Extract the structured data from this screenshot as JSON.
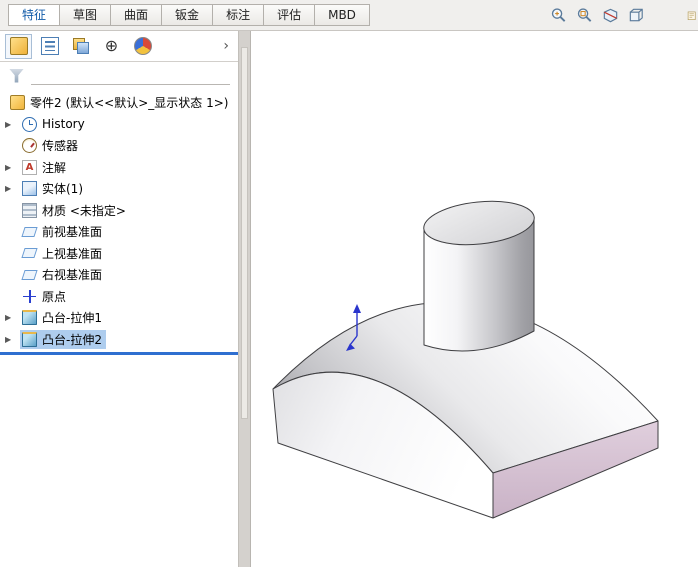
{
  "colors": {
    "selection_highlight": "#aecdee",
    "rollback_bar": "#2f6fd0",
    "right_face_pink": "#d6c0d4",
    "accent_blue": "#0f5aa8"
  },
  "ribbon": {
    "tabs": [
      {
        "id": "features",
        "label": "特征",
        "active": true
      },
      {
        "id": "sketch",
        "label": "草图",
        "active": false
      },
      {
        "id": "surfaces",
        "label": "曲面",
        "active": false
      },
      {
        "id": "sheet-metal",
        "label": "钣金",
        "active": false
      },
      {
        "id": "markup",
        "label": "标注",
        "active": false
      },
      {
        "id": "evaluate",
        "label": "评估",
        "active": false
      },
      {
        "id": "mbd",
        "label": "MBD",
        "active": false
      }
    ],
    "quick_icons": [
      {
        "name": "zoom-previous-icon",
        "clipped": false
      },
      {
        "name": "zoom-fit-icon",
        "clipped": false
      },
      {
        "name": "section-view-icon",
        "clipped": false
      },
      {
        "name": "view-orientation-icon",
        "clipped": false
      },
      {
        "name": "document-icon",
        "clipped": true
      }
    ]
  },
  "panel": {
    "expand_glyph": "▶",
    "tabs_overflow": "›",
    "tabs": [
      {
        "name": "featuremanager-tab",
        "icon": "feature",
        "active": true,
        "glyph": ""
      },
      {
        "name": "propertymanager-tab",
        "icon": "property",
        "active": false,
        "glyph": ""
      },
      {
        "name": "configurationmanager-tab",
        "icon": "config",
        "active": false,
        "glyph": ""
      },
      {
        "name": "dimxpertmanager-tab",
        "icon": "dimxpert",
        "active": false,
        "glyph": "⊕"
      },
      {
        "name": "displaymanager-tab",
        "icon": "display",
        "active": false,
        "glyph": ""
      }
    ],
    "tree": {
      "root": {
        "label": "零件2 (默认<<默认>_显示状态 1>)"
      },
      "items": [
        {
          "id": "history",
          "label": "History",
          "icon": "history",
          "arrow": true,
          "selected": false
        },
        {
          "id": "sensors",
          "label": "传感器",
          "icon": "sensor",
          "arrow": false,
          "selected": false
        },
        {
          "id": "annotations",
          "label": "注解",
          "icon": "annot",
          "arrow": true,
          "selected": false
        },
        {
          "id": "solid-bodies",
          "label": "实体(1)",
          "icon": "bodies",
          "arrow": true,
          "selected": false
        },
        {
          "id": "material",
          "label": "材质 <未指定>",
          "icon": "material",
          "arrow": false,
          "selected": false
        },
        {
          "id": "front-plane",
          "label": "前视基准面",
          "icon": "plane",
          "arrow": false,
          "selected": false
        },
        {
          "id": "top-plane",
          "label": "上视基准面",
          "icon": "plane",
          "arrow": false,
          "selected": false
        },
        {
          "id": "right-plane",
          "label": "右视基准面",
          "icon": "plane",
          "arrow": false,
          "selected": false
        },
        {
          "id": "origin",
          "label": "原点",
          "icon": "origin",
          "arrow": false,
          "selected": false
        },
        {
          "id": "boss-extrude1",
          "label": "凸台-拉伸1",
          "icon": "extrude",
          "arrow": true,
          "selected": false
        },
        {
          "id": "boss-extrude2",
          "label": "凸台-拉伸2",
          "icon": "extrude",
          "arrow": true,
          "selected": true
        }
      ]
    }
  },
  "viewport": {
    "model": "arch-base-with-cylinder-boss"
  }
}
